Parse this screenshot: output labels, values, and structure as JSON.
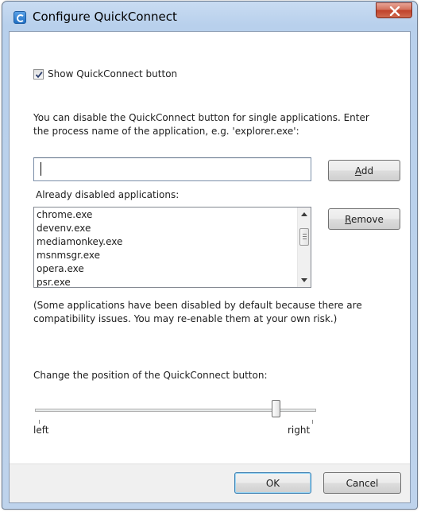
{
  "window": {
    "title": "Configure QuickConnect",
    "close_glyph": "✕"
  },
  "show_button": {
    "label": "Show QuickConnect button",
    "checked": true
  },
  "description": [
    "You can disable the QuickConnect button for single applications. Enter",
    "the process name of the application, e.g. 'explorer.exe':"
  ],
  "process_input": {
    "value": ""
  },
  "add_button": {
    "label_accel": "A",
    "label_rest": "dd"
  },
  "disabled_list": {
    "label": "Already disabled applications:",
    "items": [
      "chrome.exe",
      "devenv.exe",
      "mediamonkey.exe",
      "msnmsgr.exe",
      "opera.exe",
      "psr.exe"
    ]
  },
  "remove_button": {
    "label_accel": "R",
    "label_rest": "emove"
  },
  "note": [
    "(Some applications have been disabled by default because there are",
    "compatibility issues. You may re-enable them at your own risk.)"
  ],
  "position": {
    "label": "Change the position of the QuickConnect button:",
    "left_label": "left",
    "right_label": "right",
    "value": 0.88
  },
  "ok_button": {
    "label": "OK"
  },
  "cancel_button": {
    "label": "Cancel"
  },
  "icons": {
    "app": "quickconnect-app-icon",
    "close": "close-icon",
    "check": "checkmark-icon"
  }
}
